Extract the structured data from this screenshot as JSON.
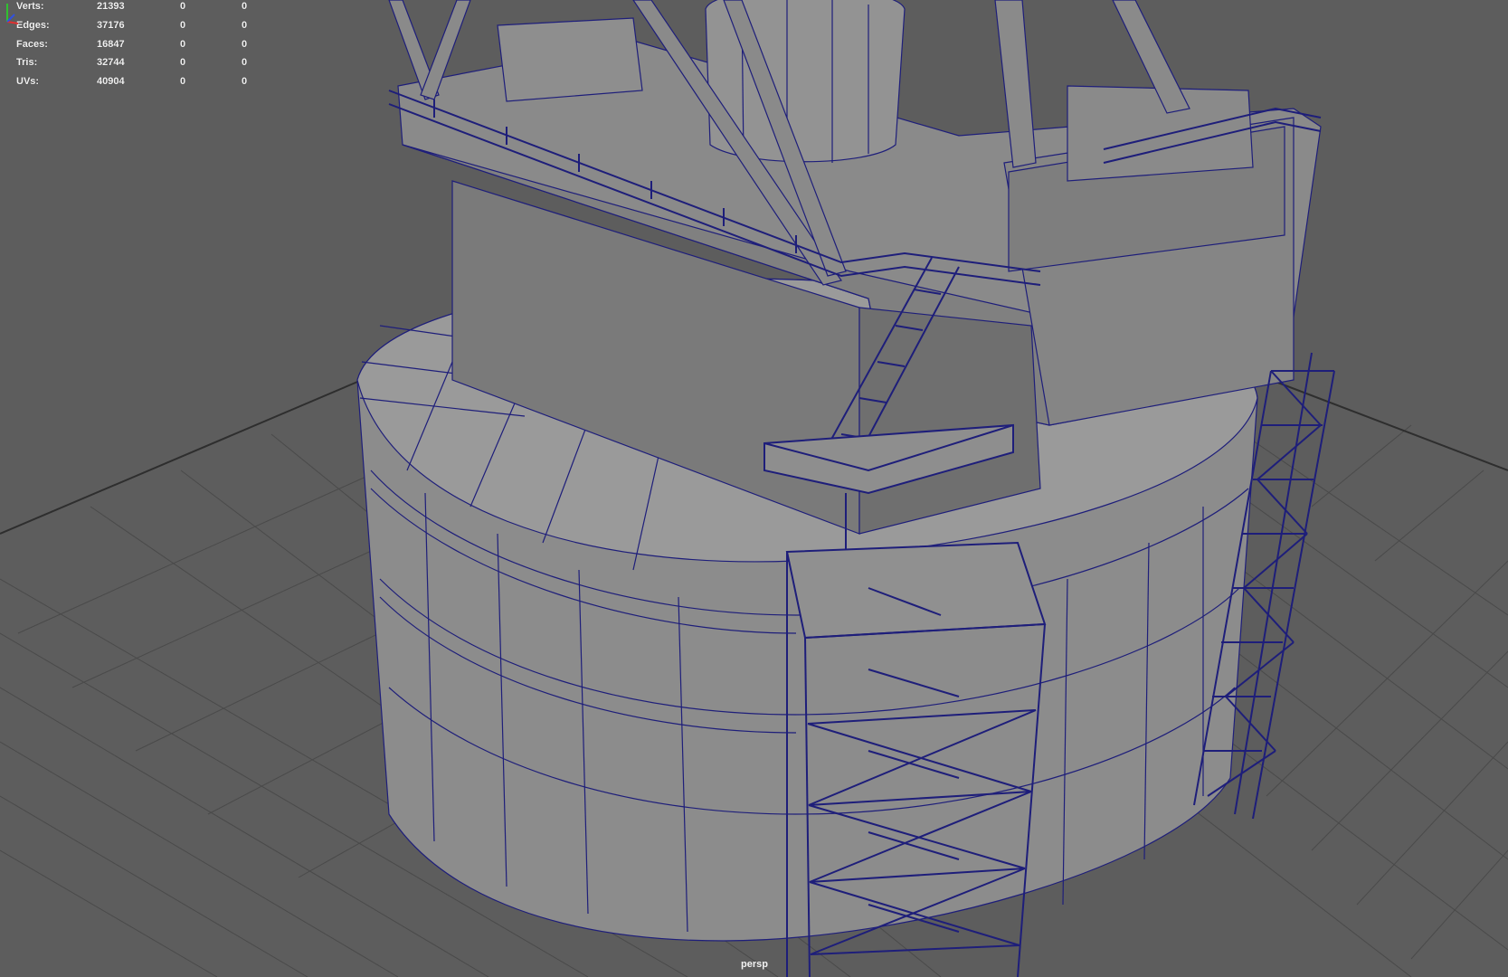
{
  "heads_up_display": {
    "rows": [
      {
        "label": "Verts:",
        "values": [
          "21393",
          "0",
          "0"
        ]
      },
      {
        "label": "Edges:",
        "values": [
          "37176",
          "0",
          "0"
        ]
      },
      {
        "label": "Faces:",
        "values": [
          "16847",
          "0",
          "0"
        ]
      },
      {
        "label": "Tris:",
        "values": [
          "32744",
          "0",
          "0"
        ]
      },
      {
        "label": "UVs:",
        "values": [
          "40904",
          "0",
          "0"
        ]
      }
    ]
  },
  "viewport": {
    "camera_label": "persp",
    "background_color": "#5d5d5d",
    "grid_color": "#4a4a4a",
    "grid_axis_color": "#2e2e2e",
    "mesh_fill_color": "#8f8f8f",
    "wireframe_color": "#1e1e7a"
  },
  "axis_gizmo": {
    "axes": [
      {
        "name": "x",
        "color": "#e03030"
      },
      {
        "name": "y",
        "color": "#30c030"
      },
      {
        "name": "z",
        "color": "#3050e0"
      }
    ]
  }
}
